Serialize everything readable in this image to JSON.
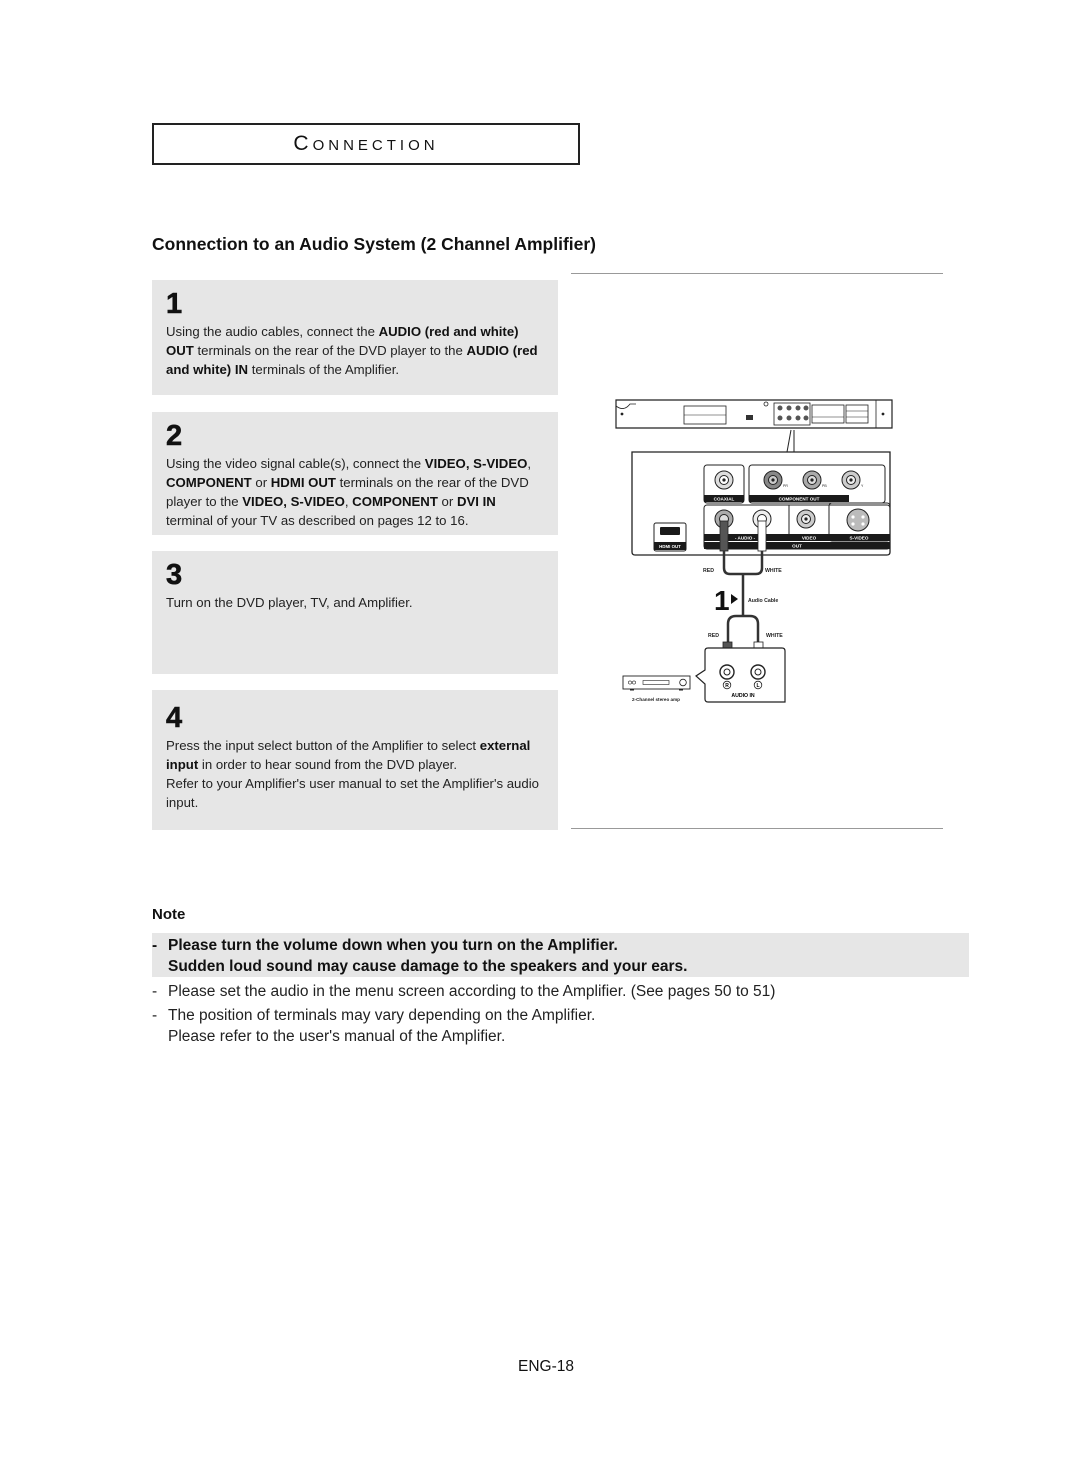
{
  "section_title": "Connection",
  "heading": "Connection to an Audio System (2 Channel Amplifier)",
  "steps": [
    {
      "number": "1",
      "segments": [
        {
          "text": "Using the audio cables, connect the ",
          "bold": false
        },
        {
          "text": "AUDIO (red and white) OUT",
          "bold": true
        },
        {
          "text": " terminals on the rear of the DVD player to the ",
          "bold": false
        },
        {
          "text": "AUDIO (red and white) IN",
          "bold": true
        },
        {
          "text": " terminals of the Amplifier.",
          "bold": false
        }
      ]
    },
    {
      "number": "2",
      "segments": [
        {
          "text": "Using the video signal cable(s), connect the ",
          "bold": false
        },
        {
          "text": "VIDEO, S-VIDEO",
          "bold": true
        },
        {
          "text": ", ",
          "bold": false
        },
        {
          "text": "COMPONENT",
          "bold": true
        },
        {
          "text": " or ",
          "bold": false
        },
        {
          "text": "HDMI OUT",
          "bold": true
        },
        {
          "text": " terminals on the rear of the DVD player to the ",
          "bold": false
        },
        {
          "text": "VIDEO, S-VIDEO",
          "bold": true
        },
        {
          "text": ", ",
          "bold": false
        },
        {
          "text": "COMPONENT",
          "bold": true
        },
        {
          "text": " or ",
          "bold": false
        },
        {
          "text": "DVI IN",
          "bold": true
        },
        {
          "text": " terminal of your TV as described on pages 12 to 16.",
          "bold": false
        }
      ]
    },
    {
      "number": "3",
      "segments": [
        {
          "text": "Turn on the DVD player, TV, and Amplifier.",
          "bold": false
        }
      ]
    },
    {
      "number": "4",
      "segments": [
        {
          "text": "Press the input select button of the Amplifier to select ",
          "bold": false
        },
        {
          "text": "external input",
          "bold": true
        },
        {
          "text": "  in order to hear sound from the DVD player.",
          "bold": false
        },
        {
          "text": "\n",
          "bold": false
        },
        {
          "text": "Refer to your Amplifier's user manual to set the Amplifier's audio input.",
          "bold": false
        }
      ]
    }
  ],
  "diagram": {
    "coaxial_label": "COAXIAL",
    "component_out_label": "COMPONENT OUT",
    "hdmi_out_label": "HDMI OUT",
    "audio_label": "- AUDIO -",
    "video_label": "VIDEO",
    "svideo_label": "S-VIDEO",
    "out_label": "OUT",
    "red_label": "RED",
    "white_label": "WHITE",
    "step_marker": "1",
    "cable_label": "Audio Cable",
    "r_label": "R",
    "l_label": "L",
    "audio_in_label": "AUDIO IN",
    "amp_label": "2-Channel stereo amp",
    "component_letters": [
      "PR",
      "PB",
      "Y"
    ],
    "colors": {
      "red_plug": "#555555",
      "white_plug": "#ffffff",
      "panel_dark": "#1a1a1a"
    }
  },
  "note": {
    "title": "Note",
    "items": [
      {
        "dash": "-",
        "line1": "Please turn the volume down when you turn on the Amplifier.",
        "line2": "Sudden loud sound may cause  damage to the speakers and your ears.",
        "highlight": true
      },
      {
        "dash": "-",
        "line1": "Please set the audio in the menu screen according to the Amplifier. (See pages 50 to 51)",
        "line2": null,
        "highlight": false
      },
      {
        "dash": "-",
        "line1": "The position of terminals may vary depending on the Amplifier.",
        "line2": "Please refer to the user's manual of the Amplifier.",
        "highlight": false
      }
    ]
  },
  "page_number": "ENG-18"
}
